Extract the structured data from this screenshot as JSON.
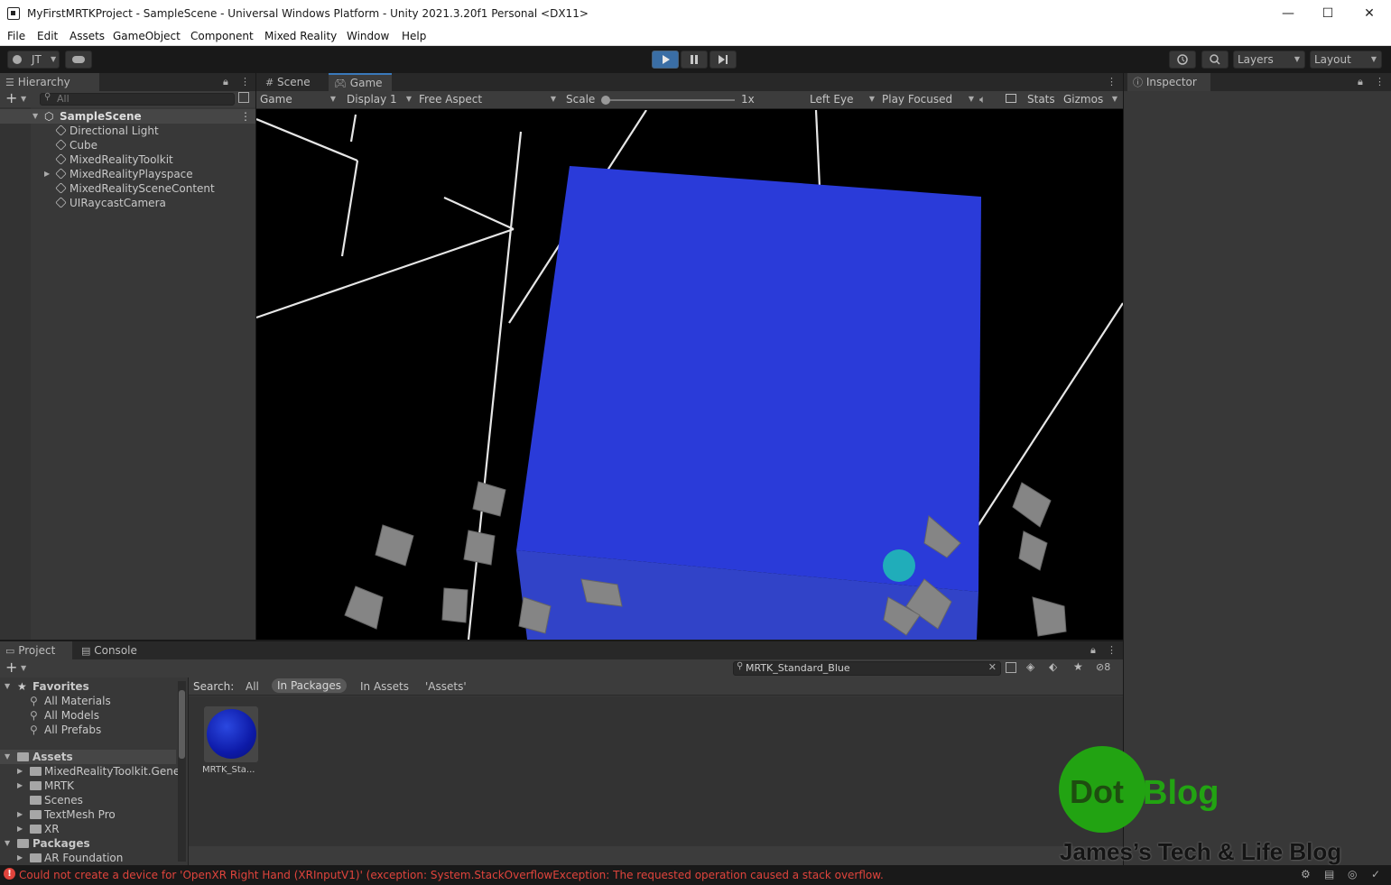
{
  "window": {
    "title": "MyFirstMRTKProject - SampleScene - Universal Windows Platform - Unity 2021.3.20f1 Personal <DX11>",
    "minimize_glyph": "—",
    "maximize_glyph": "☐",
    "close_glyph": "✕"
  },
  "menu": [
    "File",
    "Edit",
    "Assets",
    "GameObject",
    "Component",
    "Mixed Reality",
    "Window",
    "Help"
  ],
  "toolbar": {
    "account": "JT",
    "layers": "Layers",
    "layout": "Layout",
    "history_icon": "history-icon",
    "search_icon": "search-icon",
    "cloud_icon": "cloud-icon"
  },
  "hierarchy": {
    "tab": "Hierarchy",
    "search_placeholder": "All",
    "scene": "SampleScene",
    "items": [
      "Directional Light",
      "Cube",
      "MixedRealityToolkit",
      "MixedRealityPlayspace",
      "MixedRealitySceneContent",
      "UIRaycastCamera"
    ]
  },
  "view": {
    "tab_scene": "Scene",
    "tab_game": "Game",
    "game_mode": "Game",
    "display": "Display 1",
    "aspect": "Free Aspect",
    "scale_label": "Scale",
    "scale_value": "1x",
    "eye": "Left Eye",
    "play_mode": "Play Focused",
    "stats": "Stats",
    "gizmos": "Gizmos"
  },
  "inspector": {
    "tab": "Inspector"
  },
  "project": {
    "tab_project": "Project",
    "tab_console": "Console",
    "search_value": "MRTK_Standard_Blue",
    "hidden_count": "8",
    "search_label": "Search:",
    "scopes": [
      "All",
      "In Packages",
      "In Assets",
      "'Assets'"
    ],
    "favorites_label": "Favorites",
    "favorites": [
      "All Materials",
      "All Models",
      "All Prefabs"
    ],
    "assets_label": "Assets",
    "assets": [
      "MixedRealityToolkit.Gene",
      "MRTK",
      "Scenes",
      "TextMesh Pro",
      "XR"
    ],
    "packages_label": "Packages",
    "packages": [
      "AR Foundation"
    ],
    "asset_item": "MRTK_Sta..."
  },
  "status": {
    "error": "Could not create a device for 'OpenXR Right Hand (XRInputV1)' (exception: System.StackOverflowException: The requested operation caused a stack overflow."
  },
  "watermark": {
    "logo_dot": "Dot",
    "logo_blog": "Blog",
    "tagline": "James’s Tech & Life Blog"
  },
  "colors": {
    "accent": "#3a79bb",
    "cube_blue": "#2a3bd9",
    "error": "#e0443c",
    "logo_green": "#22a312"
  }
}
